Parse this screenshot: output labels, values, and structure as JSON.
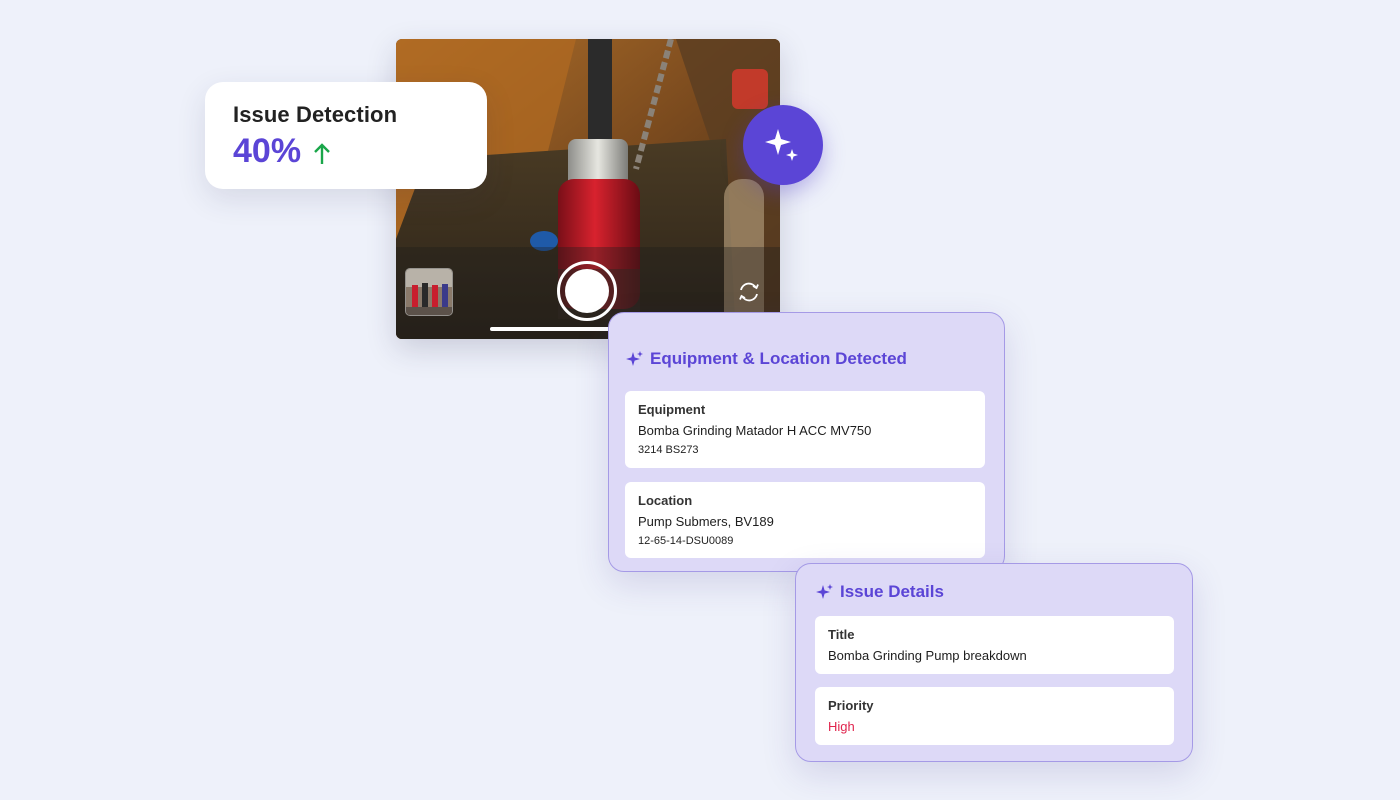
{
  "issue_stat": {
    "title": "Issue Detection",
    "value": "40%",
    "trend_icon": "arrow-up-icon",
    "trend_color": "#1aa64a"
  },
  "camera": {
    "shutter_icon": "shutter-button",
    "switch_icon": "switch-camera-icon",
    "thumbnail": "gallery-thumbnail"
  },
  "ai_badge": {
    "icon": "sparkle-icon",
    "color": "#5b45d6"
  },
  "equipment_panel": {
    "title": "Equipment & Location Detected",
    "equipment": {
      "label": "Equipment",
      "value": "Bomba Grinding Matador H ACC MV750",
      "code": "3214 BS273"
    },
    "location": {
      "label": "Location",
      "value": "Pump Submers, BV189",
      "code": "12-65-14-DSU0089"
    }
  },
  "issue_panel": {
    "title": "Issue Details",
    "title_field": {
      "label": "Title",
      "value": "Bomba Grinding Pump breakdown"
    },
    "priority_field": {
      "label": "Priority",
      "value": "High",
      "color": "#e0244d"
    }
  },
  "colors": {
    "accent": "#5b45d6",
    "panel_bg": "#ddd9f7",
    "page_bg": "#eef1fa"
  }
}
